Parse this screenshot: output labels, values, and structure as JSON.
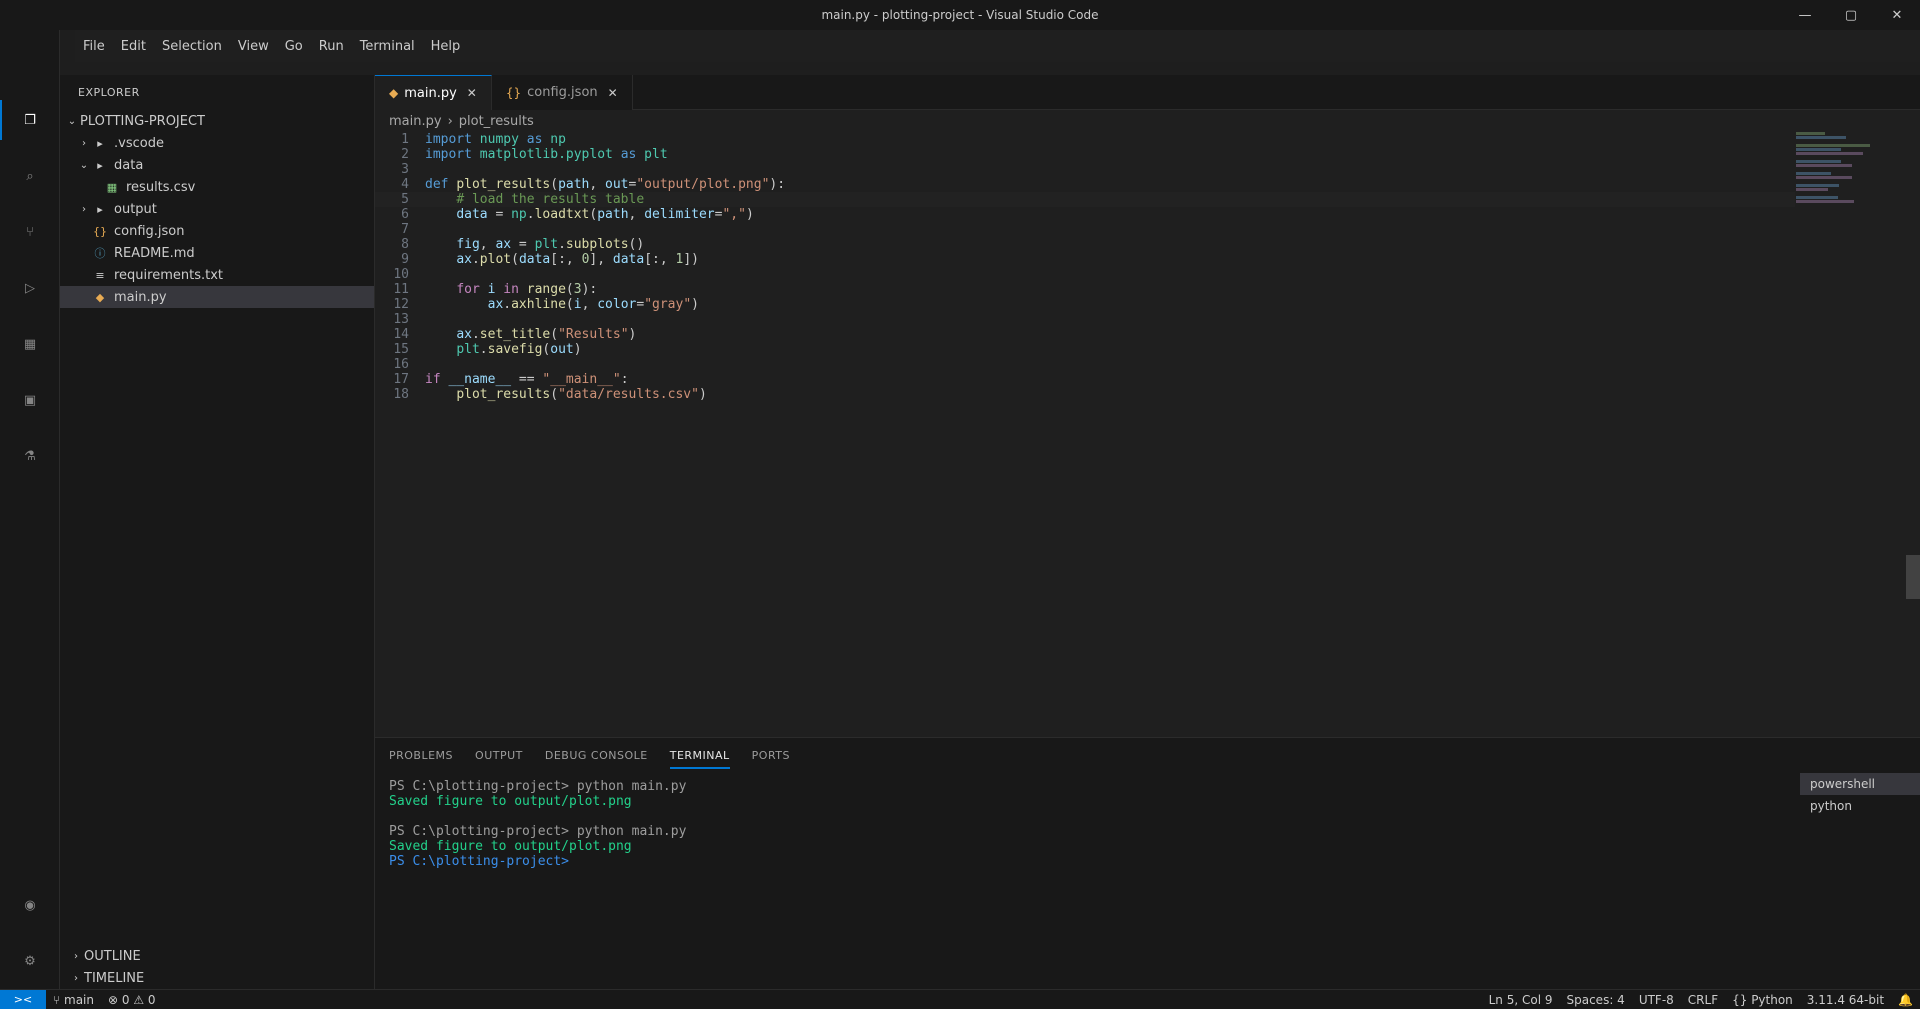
{
  "window": {
    "title": "main.py - plotting-project - Visual Studio Code",
    "controls": [
      "—",
      "▢",
      "✕"
    ]
  },
  "menu": [
    "File",
    "Edit",
    "Selection",
    "View",
    "Go",
    "Run",
    "Terminal",
    "Help"
  ],
  "activity": [
    {
      "name": "explorer",
      "glyph": "❐"
    },
    {
      "name": "search",
      "glyph": "⌕"
    },
    {
      "name": "source-control",
      "glyph": "⑂"
    },
    {
      "name": "run-debug",
      "glyph": "▷"
    },
    {
      "name": "extensions",
      "glyph": "▦"
    },
    {
      "name": "remote",
      "glyph": "▣"
    },
    {
      "name": "testing",
      "glyph": "⚗"
    }
  ],
  "activity_bottom": [
    {
      "name": "accounts",
      "glyph": "◉"
    },
    {
      "name": "settings",
      "glyph": "⚙"
    }
  ],
  "sidebar": {
    "header": "EXPLORER",
    "items": [
      {
        "label": "PLOTTING-PROJECT",
        "indent": 0,
        "chev": "⌄",
        "icon": "",
        "color": "#cccccc"
      },
      {
        "label": ".vscode",
        "indent": 1,
        "chev": "›",
        "icon": "▸",
        "color": "#cccccc"
      },
      {
        "label": "data",
        "indent": 1,
        "chev": "⌄",
        "icon": "▸",
        "color": "#cccccc"
      },
      {
        "label": "results.csv",
        "indent": 2,
        "chev": "",
        "icon": "▦",
        "color": "#89d185"
      },
      {
        "label": "output",
        "indent": 1,
        "chev": "›",
        "icon": "▸",
        "color": "#cccccc"
      },
      {
        "label": "config.json",
        "indent": 1,
        "chev": "",
        "icon": "{}",
        "color": "#e8ab53"
      },
      {
        "label": "README.md",
        "indent": 1,
        "chev": "",
        "icon": "ⓘ",
        "color": "#519aba"
      },
      {
        "label": "requirements.txt",
        "indent": 1,
        "chev": "",
        "icon": "≡",
        "color": "#cccccc"
      },
      {
        "label": "main.py",
        "indent": 1,
        "chev": "",
        "icon": "◆",
        "color": "#e8ab53",
        "selected": true
      }
    ],
    "footer": [
      {
        "label": "OUTLINE",
        "chev": "›"
      },
      {
        "label": "TIMELINE",
        "chev": "›"
      }
    ]
  },
  "tabs": [
    {
      "label": "main.py",
      "active": true,
      "dirty": false
    },
    {
      "label": "config.json",
      "active": false,
      "dirty": false
    }
  ],
  "breadcrumb": [
    "main.py",
    "›",
    "plot_results"
  ],
  "code": [
    {
      "n": "1",
      "html": "<span class='kw'>import</span> <span class='ty'>numpy</span> <span class='kw'>as</span> <span class='ty'>np</span>"
    },
    {
      "n": "2",
      "html": "<span class='kw'>import</span> <span class='ty'>matplotlib.pyplot</span> <span class='kw'>as</span> <span class='ty'>plt</span>"
    },
    {
      "n": "3",
      "html": ""
    },
    {
      "n": "4",
      "html": "<span class='kw'>def</span> <span class='fn'>plot_results</span>(<span class='var'>path</span>, <span class='var'>out</span>=<span class='str'>\"output/plot.png\"</span>):"
    },
    {
      "n": "5",
      "html": "    <span class='cm'># load the results table</span>",
      "current": true
    },
    {
      "n": "6",
      "html": "    <span class='var'>data</span> = <span class='ty'>np</span>.<span class='fn'>loadtxt</span>(<span class='var'>path</span>, <span class='var'>delimiter</span>=<span class='str'>\",\"</span>)"
    },
    {
      "n": "7",
      "html": ""
    },
    {
      "n": "8",
      "html": "    <span class='var'>fig</span>, <span class='var'>ax</span> = <span class='ty'>plt</span>.<span class='fn'>subplots</span>()"
    },
    {
      "n": "9",
      "html": "    <span class='var'>ax</span>.<span class='fn'>plot</span>(<span class='var'>data</span>[:, <span class='num'>0</span>], <span class='var'>data</span>[:, <span class='num'>1</span>])"
    },
    {
      "n": "10",
      "html": ""
    },
    {
      "n": "11",
      "html": "    <span class='ctl'>for</span> <span class='var'>i</span> <span class='ctl'>in</span> <span class='fn'>range</span>(<span class='num'>3</span>):"
    },
    {
      "n": "12",
      "html": "        <span class='var'>ax</span>.<span class='fn'>axhline</span>(<span class='var'>i</span>, <span class='var'>color</span>=<span class='str'>\"gray\"</span>)"
    },
    {
      "n": "13",
      "html": ""
    },
    {
      "n": "14",
      "html": "    <span class='var'>ax</span>.<span class='fn'>set_title</span>(<span class='str'>\"Results\"</span>)"
    },
    {
      "n": "15",
      "html": "    <span class='ty'>plt</span>.<span class='fn'>savefig</span>(<span class='var'>out</span>)"
    },
    {
      "n": "16",
      "html": ""
    },
    {
      "n": "17",
      "html": "<span class='ctl'>if</span> <span class='var'>__name__</span> == <span class='str'>\"__main__\"</span>:"
    },
    {
      "n": "18",
      "html": "    <span class='fn'>plot_results</span>(<span class='str'>\"data/results.csv\"</span>)"
    }
  ],
  "panel": {
    "tabs": [
      {
        "label": "PROBLEMS",
        "active": false
      },
      {
        "label": "OUTPUT",
        "active": false
      },
      {
        "label": "DEBUG CONSOLE",
        "active": false
      },
      {
        "label": "TERMINAL",
        "active": true
      },
      {
        "label": "PORTS",
        "active": false
      }
    ],
    "terminal": [
      {
        "cls": "t-dim",
        "text": "PS C:\\plotting-project> python main.py"
      },
      {
        "cls": "t-ok",
        "text": "Saved figure to output/plot.png"
      },
      {
        "cls": "t-dim",
        "text": ""
      },
      {
        "cls": "t-dim",
        "text": "PS C:\\plotting-project> python main.py"
      },
      {
        "cls": "t-ok",
        "text": "Saved figure to output/plot.png"
      },
      {
        "cls": "t-blue",
        "text": "PS C:\\plotting-project> "
      }
    ],
    "terminals": [
      "powershell",
      "python"
    ]
  },
  "status": {
    "remote": "><",
    "left": [
      "⑂ main",
      "⊗ 0  ⚠ 0"
    ],
    "right": [
      "Ln 5, Col 9",
      "Spaces: 4",
      "UTF-8",
      "CRLF",
      "{} Python",
      "3.11.4 64-bit",
      "🔔"
    ]
  },
  "colors": {
    "accent": "#0078d4",
    "background": "#1e1e1e",
    "sidebar": "#181818"
  }
}
